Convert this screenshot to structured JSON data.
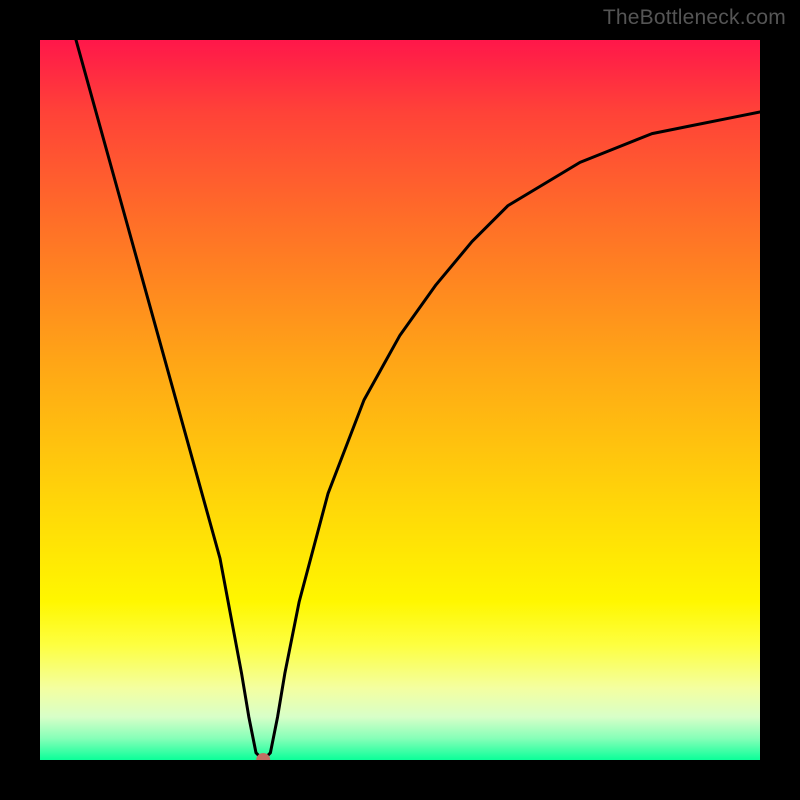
{
  "watermark": "TheBottleneck.com",
  "chart_data": {
    "type": "line",
    "title": "",
    "xlabel": "",
    "ylabel": "",
    "xlim": [
      0,
      100
    ],
    "ylim": [
      0,
      100
    ],
    "minimum_marker": {
      "x": 31,
      "y": 0
    },
    "series": [
      {
        "name": "bottleneck-curve",
        "x": [
          5,
          10,
          15,
          20,
          25,
          28,
          29,
          30,
          31,
          32,
          33,
          34,
          36,
          40,
          45,
          50,
          55,
          60,
          65,
          70,
          75,
          80,
          85,
          90,
          95,
          100
        ],
        "values": [
          100,
          82,
          64,
          46,
          28,
          12,
          6,
          1,
          0,
          1,
          6,
          12,
          22,
          37,
          50,
          59,
          66,
          72,
          77,
          80,
          83,
          85,
          87,
          88,
          89,
          90
        ]
      }
    ],
    "background_gradient": {
      "stops": [
        {
          "pos": 0.0,
          "color": "#ff174a"
        },
        {
          "pos": 0.1,
          "color": "#ff4238"
        },
        {
          "pos": 0.25,
          "color": "#ff6e28"
        },
        {
          "pos": 0.45,
          "color": "#ffa616"
        },
        {
          "pos": 0.65,
          "color": "#ffd808"
        },
        {
          "pos": 0.78,
          "color": "#fff700"
        },
        {
          "pos": 0.84,
          "color": "#fdff40"
        },
        {
          "pos": 0.9,
          "color": "#f4ffa0"
        },
        {
          "pos": 0.94,
          "color": "#d8ffc8"
        },
        {
          "pos": 0.97,
          "color": "#86ffb8"
        },
        {
          "pos": 1.0,
          "color": "#0bff99"
        }
      ]
    }
  }
}
